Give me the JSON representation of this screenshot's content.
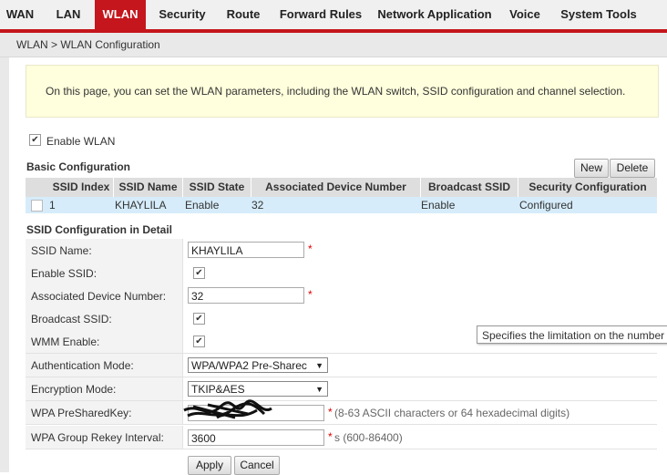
{
  "nav": {
    "tabs": [
      {
        "label": "WAN"
      },
      {
        "label": "LAN"
      },
      {
        "label": "WLAN"
      },
      {
        "label": "Security"
      },
      {
        "label": "Route"
      },
      {
        "label": "Forward Rules"
      },
      {
        "label": "Network Application"
      },
      {
        "label": "Voice"
      },
      {
        "label": "System Tools"
      }
    ],
    "active_tab": "WLAN",
    "accent_color": "#c4161c"
  },
  "breadcrumb": "WLAN > WLAN Configuration",
  "info_text": "On this page, you can set the WLAN parameters, including the WLAN switch, SSID configuration and channel selection.",
  "enable_wlan": {
    "label": "Enable WLAN",
    "checked": true
  },
  "basic": {
    "title": "Basic Configuration",
    "new_label": "New",
    "delete_label": "Delete",
    "columns": [
      "SSID Index",
      "SSID Name",
      "SSID State",
      "Associated Device Number",
      "Broadcast SSID",
      "Security Configuration"
    ],
    "rows": [
      {
        "index": "1",
        "name": "KHAYLILA",
        "state": "Enable",
        "devices": "32",
        "broadcast": "Enable",
        "security": "Configured"
      }
    ]
  },
  "detail": {
    "title": "SSID Configuration in Detail",
    "ssid_name_label": "SSID Name:",
    "ssid_name_value": "KHAYLILA",
    "enable_ssid_label": "Enable SSID:",
    "assoc_label": "Associated Device Number:",
    "assoc_value": "32",
    "broadcast_label": "Broadcast SSID:",
    "wmm_label": "WMM Enable:",
    "auth_label": "Authentication Mode:",
    "auth_value": "WPA/WPA2 Pre-Sharec",
    "enc_label": "Encryption Mode:",
    "enc_value": "TKIP&AES",
    "psk_label": "WPA PreSharedKey:",
    "psk_hint": "(8-63 ASCII characters or 64 hexadecimal digits)",
    "rekey_label": "WPA Group Rekey Interval:",
    "rekey_value": "3600",
    "rekey_hint": "s (600-86400)",
    "required_mark": "*",
    "checkmark": "✔"
  },
  "tooltip": "Specifies the limitation on the number",
  "apply_label": "Apply",
  "cancel_label": "Cancel"
}
